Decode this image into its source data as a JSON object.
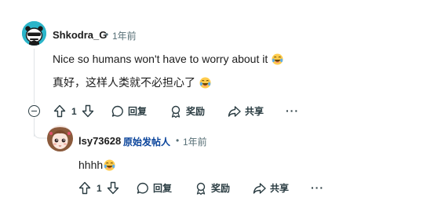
{
  "comment": {
    "username": "Shkodra_G",
    "dot": "•",
    "time": "1年前",
    "line1": "Nice so humans won't have to worry about it",
    "line2": "真好，这样人类就不必担心了",
    "emoji": "face-with-tears-of-joy",
    "actions": {
      "votes": "1",
      "reply": "回复",
      "award": "奖励",
      "share": "共享",
      "more": "···"
    }
  },
  "reply": {
    "username": "lsy73628",
    "op_badge": "原始发帖人",
    "dot": "•",
    "time": "1年前",
    "text": "hhhh",
    "emoji": "face-with-tears-of-joy",
    "actions": {
      "votes": "1",
      "reply": "回复",
      "award": "奖励",
      "share": "共享",
      "more": "···"
    }
  },
  "colors": {
    "text": "#1c1c1c",
    "meta": "#576f76",
    "op_badge": "#0a449b",
    "thread_line": "#e0e4e7",
    "avatar1_bg": "#2bb5c9"
  }
}
